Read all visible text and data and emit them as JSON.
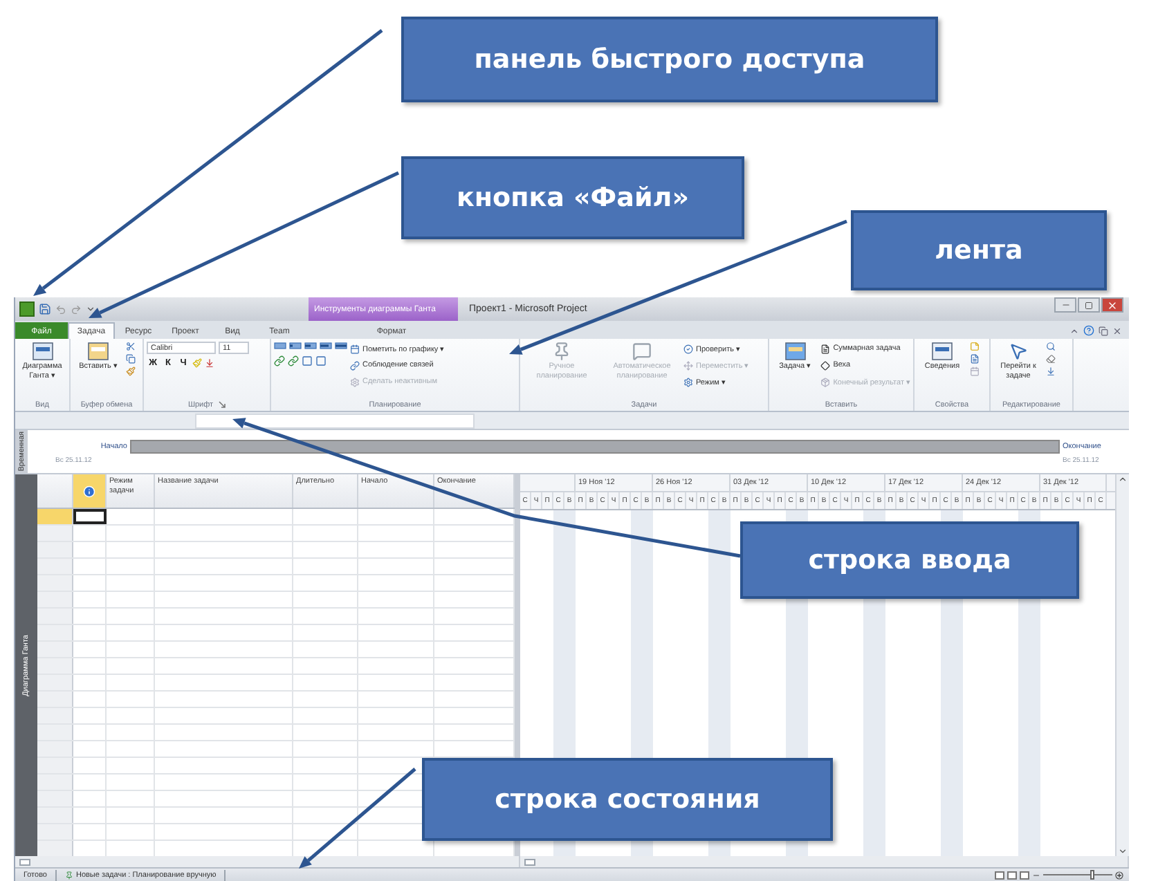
{
  "callouts": [
    {
      "text": "панель быстрого доступа"
    },
    {
      "text": "кнопка «Файл»"
    },
    {
      "text": "лента"
    },
    {
      "text": "строка ввода"
    },
    {
      "text": "строка состояния"
    }
  ],
  "window": {
    "title": "Проект1 - Microsoft Project",
    "context_header": "Инструменты диаграммы Ганта"
  },
  "tabs": [
    {
      "label": "Файл",
      "kind": "file",
      "selected": false
    },
    {
      "label": "Задача",
      "kind": "normal",
      "selected": true
    },
    {
      "label": "Ресурс",
      "kind": "normal",
      "selected": false
    },
    {
      "label": "Проект",
      "kind": "normal",
      "selected": false
    },
    {
      "label": "Вид",
      "kind": "normal",
      "selected": false
    },
    {
      "label": "Team",
      "kind": "normal",
      "selected": false
    },
    {
      "label": "Формат",
      "kind": "context",
      "selected": false
    }
  ],
  "ribbon_groups": [
    {
      "kind": "view",
      "label": "Вид",
      "items": [
        {
          "kind": "large",
          "label": "Диаграмма Ганта ▾",
          "disabled": false
        }
      ]
    },
    {
      "kind": "clipboard",
      "label": "Буфер обмена",
      "items": [
        {
          "kind": "large",
          "label": "Вставить ▾",
          "disabled": false
        }
      ]
    },
    {
      "kind": "font",
      "label": "Шрифт",
      "font": "Calibri",
      "size": "11",
      "items": [
        {
          "kind": "format",
          "label": "Ж",
          "disabled": false
        },
        {
          "kind": "format",
          "label": "К",
          "disabled": false
        },
        {
          "kind": "format",
          "label": "Ч",
          "disabled": false
        }
      ]
    },
    {
      "kind": "schedule",
      "label": "Планирование",
      "items": [
        {
          "kind": "small",
          "label": "Пометить по графику ▾",
          "disabled": false
        },
        {
          "kind": "small",
          "label": "Соблюдение связей",
          "disabled": false
        },
        {
          "kind": "small",
          "label": "Сделать неактивным",
          "disabled": true
        }
      ]
    },
    {
      "kind": "tasks",
      "label": "Задачи",
      "items": [
        {
          "kind": "large",
          "label": "Ручное планирование",
          "disabled": true
        },
        {
          "kind": "large",
          "label": "Автоматическое планирование",
          "disabled": true
        },
        {
          "kind": "small",
          "label": "Проверить ▾",
          "disabled": false
        },
        {
          "kind": "small",
          "label": "Переместить ▾",
          "disabled": true
        },
        {
          "kind": "small",
          "label": "Режим ▾",
          "disabled": false
        }
      ]
    },
    {
      "kind": "insert",
      "label": "Вставить",
      "items": [
        {
          "kind": "large",
          "label": "Задача ▾",
          "disabled": false
        },
        {
          "kind": "small",
          "label": "Суммарная задача",
          "disabled": false
        },
        {
          "kind": "small",
          "label": "Веха",
          "disabled": false
        },
        {
          "kind": "small",
          "label": "Конечный результат ▾",
          "disabled": true
        }
      ]
    },
    {
      "kind": "properties",
      "label": "Свойства",
      "items": [
        {
          "kind": "large",
          "label": "Сведения",
          "disabled": false
        }
      ]
    },
    {
      "kind": "editing",
      "label": "Редактирование",
      "items": [
        {
          "kind": "large",
          "label": "Перейти к задаче",
          "disabled": false
        }
      ]
    }
  ],
  "timeline": {
    "side_label": "Временная",
    "start_label": "Начало",
    "start_date": "Вс 25.11.12",
    "end_label": "Окончание",
    "end_date": "Вс 25.11.12"
  },
  "view_bar": {
    "label": "Диаграмма Ганта"
  },
  "table": {
    "columns": [
      {
        "label": "Режим задачи"
      },
      {
        "label": "Название задачи"
      },
      {
        "label": "Длительно"
      },
      {
        "label": "Начало"
      },
      {
        "label": "Окончание"
      }
    ],
    "rows": [
      {
        "selected": true
      },
      {
        "selected": false
      },
      {
        "selected": false
      },
      {
        "selected": false
      },
      {
        "selected": false
      },
      {
        "selected": false
      },
      {
        "selected": false
      },
      {
        "selected": false
      },
      {
        "selected": false
      },
      {
        "selected": false
      },
      {
        "selected": false
      },
      {
        "selected": false
      },
      {
        "selected": false
      },
      {
        "selected": false
      },
      {
        "selected": false
      },
      {
        "selected": false
      },
      {
        "selected": false
      },
      {
        "selected": false
      },
      {
        "selected": false
      },
      {
        "selected": false
      },
      {
        "selected": false
      }
    ]
  },
  "gantt": {
    "weeks": [
      {
        "days": [
          "С",
          "Ч",
          "П",
          "С",
          "В"
        ]
      },
      {
        "label": "19 Ноя '12",
        "days": [
          "П",
          "В",
          "С",
          "Ч",
          "П",
          "С",
          "В"
        ]
      },
      {
        "label": "26 Ноя '12",
        "days": [
          "П",
          "В",
          "С",
          "Ч",
          "П",
          "С",
          "В"
        ]
      },
      {
        "label": "03 Дек '12",
        "days": [
          "П",
          "В",
          "С",
          "Ч",
          "П",
          "С",
          "В"
        ]
      },
      {
        "label": "10 Дек '12",
        "days": [
          "П",
          "В",
          "С",
          "Ч",
          "П",
          "С",
          "В"
        ]
      },
      {
        "label": "17 Дек '12",
        "days": [
          "П",
          "В",
          "С",
          "Ч",
          "П",
          "С",
          "В"
        ]
      },
      {
        "label": "24 Дек '12",
        "days": [
          "П",
          "В",
          "С",
          "Ч",
          "П",
          "С",
          "В"
        ]
      },
      {
        "label": "31 Дек '12",
        "days": [
          "П",
          "В",
          "С",
          "Ч",
          "П",
          "С"
        ]
      }
    ]
  },
  "status_bar": {
    "ready": "Готово",
    "mode": "Новые задачи : Планирование вручную",
    "zoom": {
      "level": 0.7
    }
  }
}
